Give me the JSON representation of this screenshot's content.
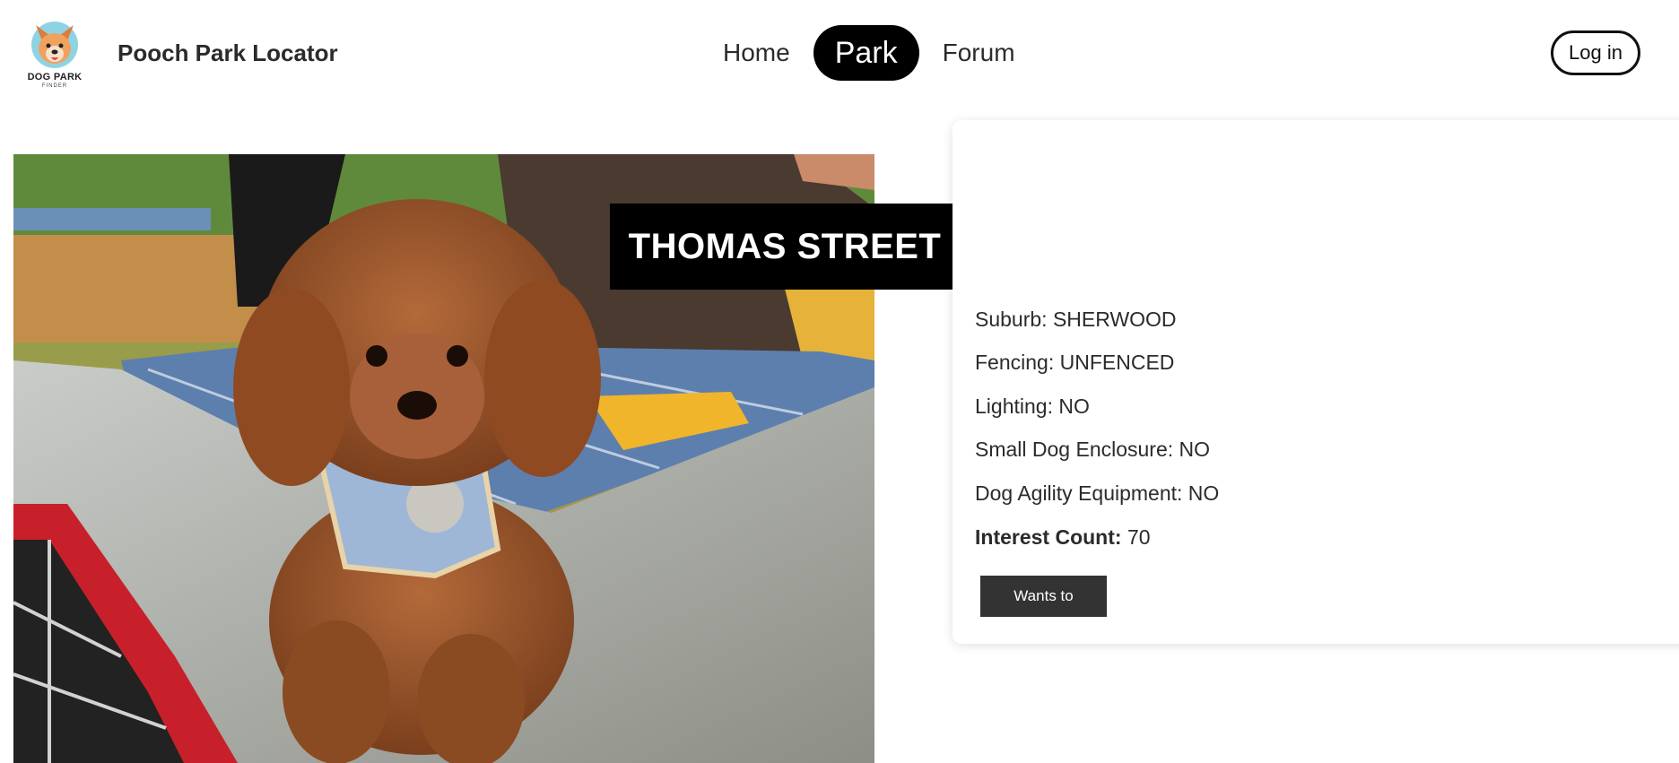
{
  "header": {
    "logo": {
      "icon": "dog-logo-icon",
      "text": "DOG PARK",
      "subtext": "FINDER"
    },
    "brand": "Pooch Park Locator",
    "nav": [
      {
        "label": "Home",
        "active": false
      },
      {
        "label": "Park",
        "active": true
      },
      {
        "label": "Forum",
        "active": false
      }
    ],
    "login_label": "Log in"
  },
  "park": {
    "name": "THOMAS STREET PARK",
    "photo_description_icon": "dog-photo",
    "suburb_label": "Suburb: ",
    "suburb": "SHERWOOD",
    "fencing_label": "Fencing: ",
    "fencing": "UNFENCED",
    "lighting_label": "Lighting: ",
    "lighting": "NO",
    "enclosure_label": "Small Dog Enclosure: ",
    "enclosure": "NO",
    "agility_label": "Dog Agility Equipment: ",
    "agility": "NO",
    "interest_label": "Interest Count:",
    "interest_count": "70",
    "wants_button": "Wants to"
  },
  "colors": {
    "accent": "#000000",
    "button": "#333333",
    "text": "#2b2b2b"
  }
}
